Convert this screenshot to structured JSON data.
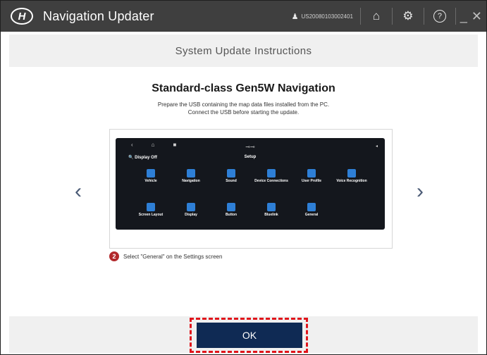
{
  "app": {
    "title": "Navigation Updater",
    "logo_mark": "H",
    "user_id": "US20080103002401"
  },
  "toolbar": {
    "user_icon": "user-icon",
    "home_icon": "home-icon",
    "settings_icon": "gear-icon",
    "help_icon": "help-icon",
    "home_glyph": "⌂",
    "settings_glyph": "⚙",
    "help_glyph": "?",
    "minimize_glyph": "_",
    "close_glyph": "✕",
    "user_glyph": "♟"
  },
  "header": {
    "title": "System Update Instructions"
  },
  "main": {
    "heading": "Standard-class Gen5W Navigation",
    "desc_line1": "Prepare the USB containing the map data files installed from the PC.",
    "desc_line2": "Connect the USB before starting the update.",
    "prev_glyph": "‹",
    "next_glyph": "›",
    "screen": {
      "search_label": "Display Off",
      "title": "Setup",
      "tiles_row1": [
        "Vehicle",
        "Navigation",
        "Sound",
        "Device Connections",
        "User Profile",
        "Voice Recognition"
      ],
      "tiles_row2": [
        "Screen Layout",
        "Display",
        "Button",
        "Bluelink",
        "General"
      ]
    },
    "step": {
      "number": "2",
      "text": "Select \"General\" on the Settings screen"
    }
  },
  "footer": {
    "ok_label": "OK"
  },
  "colors": {
    "titlebar": "#3f3f3f",
    "ok_button": "#0f2a54",
    "highlight": "#e0141b",
    "step_badge": "#b2282b"
  }
}
